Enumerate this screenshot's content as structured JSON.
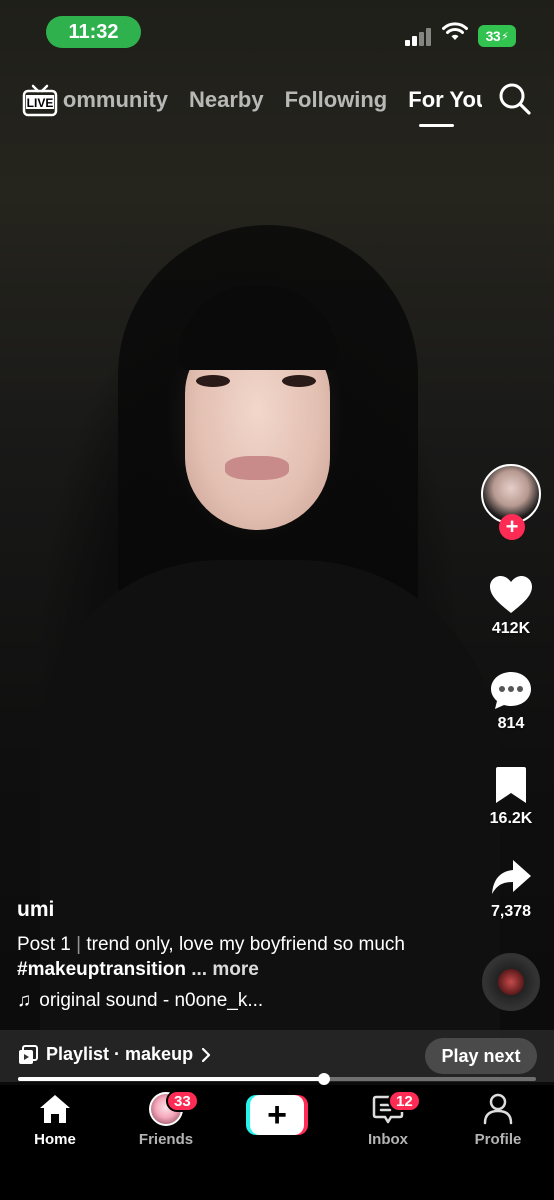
{
  "status_bar": {
    "time": "11:32",
    "battery": "33"
  },
  "top_nav": {
    "tabs": [
      {
        "label": "Community"
      },
      {
        "label": "Nearby"
      },
      {
        "label": "Following"
      },
      {
        "label": "For You"
      }
    ],
    "active_tab": "For You",
    "live_icon": "live-tv-icon",
    "search_icon": "search-icon"
  },
  "actions": {
    "likes": "412K",
    "comments": "814",
    "saves": "16.2K",
    "shares": "7,378"
  },
  "post": {
    "username": "umi",
    "caption_prefix": "Post 1",
    "caption_separator": "|",
    "caption_text": "trend only, love my boyfriend so much",
    "hashtag": "#makeuptransition",
    "more": "... more",
    "sound": "original sound - n0one_k..."
  },
  "playlist": {
    "label": "Playlist · makeup",
    "play_next": "Play next",
    "progress": 0.59
  },
  "bottom_nav": {
    "items": [
      {
        "label": "Home",
        "active": true
      },
      {
        "label": "Friends",
        "badge": "33"
      },
      {
        "label": ""
      },
      {
        "label": "Inbox",
        "badge": "12"
      },
      {
        "label": "Profile"
      }
    ]
  },
  "colors": {
    "accent": "#fe2c55",
    "cyan": "#25f4ee",
    "status_green": "#2fb24e"
  }
}
